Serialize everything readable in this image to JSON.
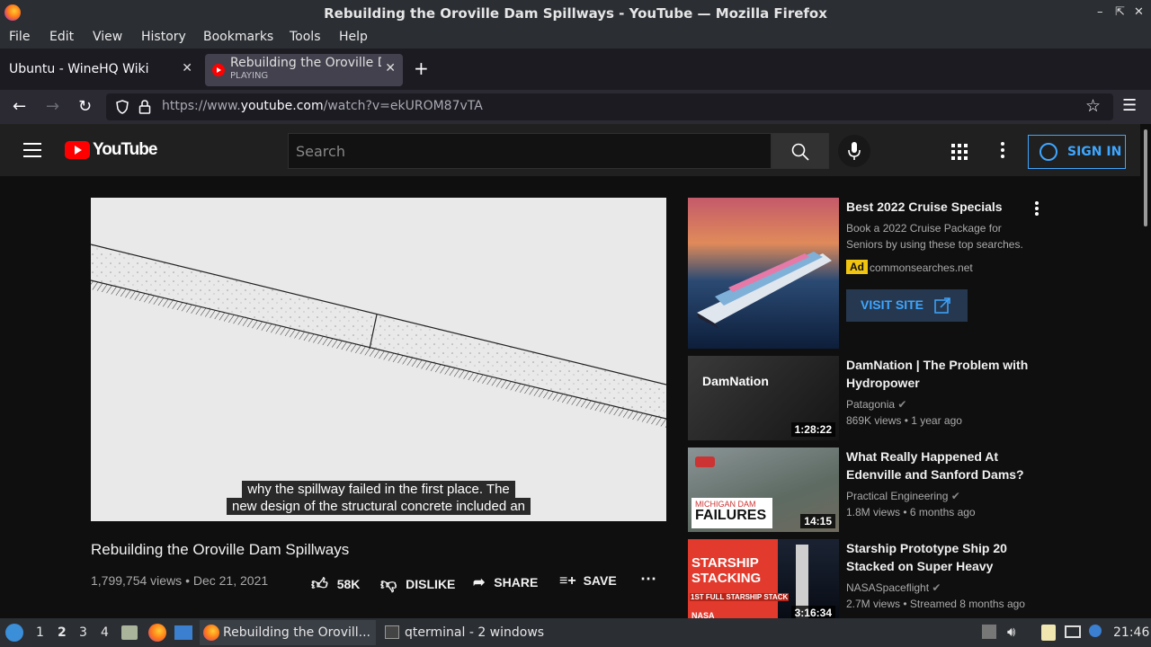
{
  "window": {
    "title": "Rebuilding the Oroville Dam Spillways - YouTube — Mozilla Firefox"
  },
  "menu": [
    "File",
    "Edit",
    "View",
    "History",
    "Bookmarks",
    "Tools",
    "Help"
  ],
  "tabs": [
    {
      "label": "Ubuntu - WineHQ Wiki"
    },
    {
      "label": "Rebuilding the Oroville Dam Spillways",
      "status": "PLAYING"
    }
  ],
  "url": {
    "prefix": "https://www.",
    "domain": "youtube.com",
    "path": "/watch?v=ekUROM87vTA"
  },
  "youtube": {
    "logo_text": "YouTube",
    "search_placeholder": "Search",
    "sign_in": "SIGN IN"
  },
  "video": {
    "caption_line1": "why the spillway failed in the first place. The",
    "caption_line2": "new design of the structural concrete included an",
    "title": "Rebuilding the Oroville Dam Spillways",
    "meta": "1,799,754 views • Dec 21, 2021",
    "likes": "58K",
    "dislike": "DISLIKE",
    "share": "SHARE",
    "save": "SAVE"
  },
  "ad": {
    "title": "Best 2022 Cruise Specials",
    "desc1": "Book a 2022 Cruise Package for",
    "desc2": "Seniors by using these top searches.",
    "badge": "Ad",
    "domain": "commonsearches.net",
    "cta": "VISIT SITE"
  },
  "related": [
    {
      "title1": "DamNation | The Problem with",
      "title2": "Hydropower",
      "channel": "Patagonia",
      "meta": "869K views • 1 year ago",
      "duration": "1:28:22",
      "thumb_text": "DamNation"
    },
    {
      "title1": "What Really Happened At",
      "title2": "Edenville and Sanford Dams?",
      "channel": "Practical Engineering",
      "meta": "1.8M views • 6 months ago",
      "duration": "14:15",
      "thumb_text1": "MICHIGAN DAM",
      "thumb_text2": "FAILURES"
    },
    {
      "title1": "Starship Prototype Ship 20",
      "title2": "Stacked on Super Heavy",
      "channel": "NASASpaceflight",
      "meta": "2.7M views • Streamed 8 months ago",
      "duration": "3:16:34",
      "thumb_text1": "STARSHIP",
      "thumb_text2": "STACKING",
      "thumb_text3": "1ST FULL STARSHIP STACK",
      "thumb_text4": "NASA"
    }
  ],
  "taskbar": {
    "workspaces": [
      "1",
      "2",
      "3",
      "4"
    ],
    "task1": "Rebuilding the Orovill...",
    "task2": "qterminal - 2 windows",
    "clock": "21:46"
  }
}
